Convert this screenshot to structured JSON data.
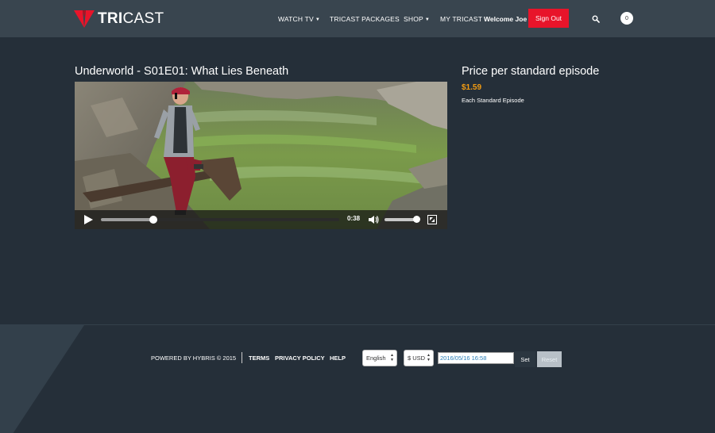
{
  "header": {
    "logo": {
      "text_bold": "TRI",
      "text_rest": "CAST"
    },
    "nav": [
      {
        "label": "WATCH TV",
        "dropdown": true
      },
      {
        "label": "TRICAST PACKAGES",
        "dropdown": false
      },
      {
        "label": "SHOP",
        "dropdown": true
      },
      {
        "label": "MY TRICAST",
        "dropdown": false
      }
    ],
    "welcome": "Welcome Joe",
    "signout_label": "Sign Out",
    "cart_count": "0"
  },
  "main": {
    "title": "Underworld - S01E01: What Lies Beneath",
    "player": {
      "time": "0:38",
      "progress": 0.22,
      "volume": 0.9
    },
    "price_title": "Price per standard episode",
    "price": "$1.59",
    "price_note": "Each Standard Episode"
  },
  "footer": {
    "powered": "POWERED BY HYBRIS © 2015",
    "links": [
      "TERMS",
      "PRIVACY POLICY",
      "HELP"
    ],
    "language": "English",
    "currency": "$ USD",
    "date_value": "2016/05/16 16:58",
    "set_label": "Set",
    "reset_label": "Reset"
  },
  "colors": {
    "background": "#252f39",
    "header": "#39454f",
    "accent_red": "#e8142a",
    "price_orange": "#f39c12"
  }
}
